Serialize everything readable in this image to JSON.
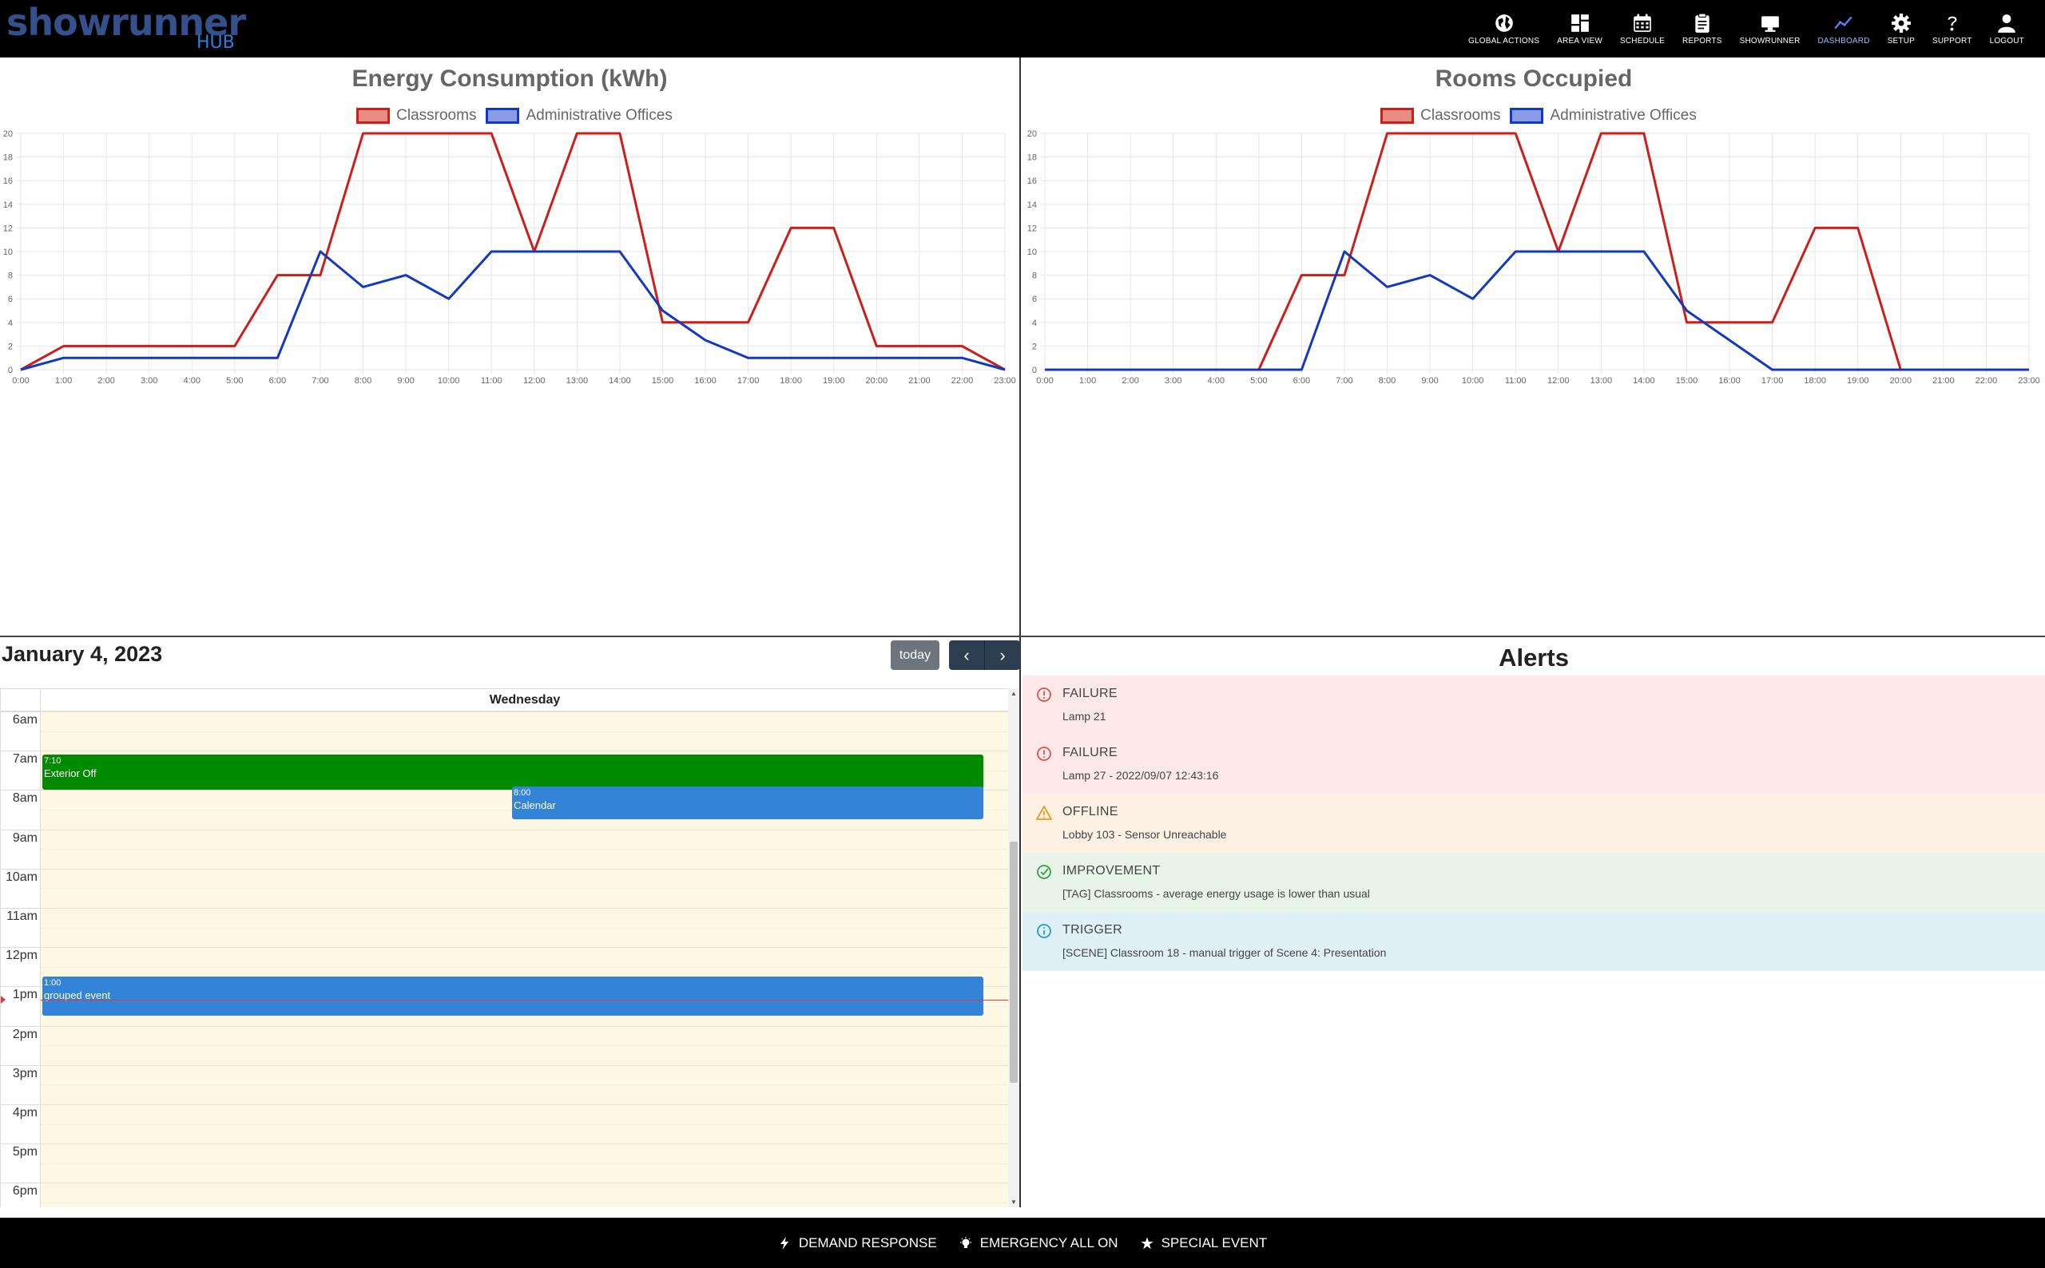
{
  "app": {
    "logo_text": "showrunner",
    "logo_sub": "HUB"
  },
  "nav": {
    "items": [
      {
        "label": "GLOBAL ACTIONS",
        "icon": "globe-icon"
      },
      {
        "label": "AREA VIEW",
        "icon": "dashboard-grid-icon"
      },
      {
        "label": "SCHEDULE",
        "icon": "calendar-icon"
      },
      {
        "label": "REPORTS",
        "icon": "clipboard-icon"
      },
      {
        "label": "SHOWRUNNER",
        "icon": "monitor-icon"
      },
      {
        "label": "DASHBOARD",
        "icon": "chart-line-icon",
        "active": true
      },
      {
        "label": "SETUP",
        "icon": "gear-icon"
      },
      {
        "label": "SUPPORT",
        "icon": "question-icon"
      },
      {
        "label": "LOGOUT",
        "icon": "user-icon"
      }
    ]
  },
  "colors": {
    "classrooms": "#cc1f1a",
    "classrooms_fill": "#e88c84",
    "admin": "#1239c0",
    "admin_fill": "#8a9ce8",
    "green_event": "#008a00",
    "blue_event": "#3383d9"
  },
  "chart_data": [
    {
      "type": "line",
      "title": "Energy Consumption (kWh)",
      "x": [
        "0:00",
        "1:00",
        "2:00",
        "3:00",
        "4:00",
        "5:00",
        "6:00",
        "7:00",
        "8:00",
        "9:00",
        "10:00",
        "11:00",
        "12:00",
        "13:00",
        "14:00",
        "15:00",
        "16:00",
        "17:00",
        "18:00",
        "19:00",
        "20:00",
        "21:00",
        "22:00",
        "23:00"
      ],
      "ylim": [
        0,
        20
      ],
      "yticks": [
        0,
        2,
        4,
        6,
        8,
        10,
        12,
        14,
        16,
        18,
        20
      ],
      "grid": true,
      "legend_position": "top",
      "series": [
        {
          "name": "Classrooms",
          "values": [
            0,
            2,
            2,
            2,
            2,
            2,
            8,
            8,
            20,
            20,
            20,
            20,
            10,
            20,
            20,
            4,
            4,
            4,
            12,
            12,
            2,
            2,
            2,
            0
          ]
        },
        {
          "name": "Administrative Offices",
          "values": [
            0,
            1,
            1,
            1,
            1,
            1,
            1,
            10,
            7,
            8,
            6,
            10,
            10,
            10,
            10,
            5,
            2.5,
            1,
            1,
            1,
            1,
            1,
            1,
            0
          ]
        }
      ]
    },
    {
      "type": "line",
      "title": "Rooms Occupied",
      "x": [
        "0:00",
        "1:00",
        "2:00",
        "3:00",
        "4:00",
        "5:00",
        "6:00",
        "7:00",
        "8:00",
        "9:00",
        "10:00",
        "11:00",
        "12:00",
        "13:00",
        "14:00",
        "15:00",
        "16:00",
        "17:00",
        "18:00",
        "19:00",
        "20:00",
        "21:00",
        "22:00",
        "23:00"
      ],
      "ylim": [
        0,
        20
      ],
      "yticks": [
        0,
        2,
        4,
        6,
        8,
        10,
        12,
        14,
        16,
        18,
        20
      ],
      "grid": true,
      "legend_position": "top",
      "series": [
        {
          "name": "Classrooms",
          "values": [
            0,
            0,
            0,
            0,
            0,
            0,
            8,
            8,
            20,
            20,
            20,
            20,
            10,
            20,
            20,
            4,
            4,
            4,
            12,
            12,
            0,
            0,
            0,
            0
          ]
        },
        {
          "name": "Administrative Offices",
          "values": [
            0,
            0,
            0,
            0,
            0,
            0,
            0,
            10,
            7,
            8,
            6,
            10,
            10,
            10,
            10,
            5,
            2.5,
            0,
            0,
            0,
            0,
            0,
            0,
            0
          ]
        }
      ]
    }
  ],
  "calendar": {
    "date_title": "January 4, 2023",
    "today_label": "today",
    "prev_label": "‹",
    "next_label": "›",
    "day_header": "Wednesday",
    "hours": [
      "6am",
      "7am",
      "8am",
      "9am",
      "10am",
      "11am",
      "12pm",
      "1pm",
      "2pm",
      "3pm",
      "4pm",
      "5pm",
      "6pm"
    ],
    "events": [
      {
        "time": "7:10",
        "title": "Exterior Off",
        "start_hour": 7.1,
        "end_hour": 8.0,
        "column": "full",
        "color": "#008a00"
      },
      {
        "time": "8:00",
        "title": "Calendar",
        "start_hour": 7.92,
        "end_hour": 8.75,
        "column": "right",
        "color": "#3383d9"
      },
      {
        "time": "1:00",
        "title": "grouped event",
        "start_hour": 12.75,
        "end_hour": 13.75,
        "column": "full",
        "color": "#3383d9"
      }
    ],
    "now_hour": 13.33
  },
  "alerts": {
    "title": "Alerts",
    "items": [
      {
        "type": "FAILURE",
        "message": "Lamp 21",
        "level": "failure",
        "icon": "error-circle-icon",
        "bg": "#fce8e8",
        "icon_color": "#d9534f"
      },
      {
        "type": "FAILURE",
        "message": "Lamp 27 - 2022/09/07 12:43:16",
        "level": "failure",
        "icon": "error-circle-icon",
        "bg": "#fce8e8",
        "icon_color": "#d9534f"
      },
      {
        "type": "OFFLINE",
        "message": "Lobby 103 - Sensor Unreachable",
        "level": "warning",
        "icon": "warning-triangle-icon",
        "bg": "#fcf1e3",
        "icon_color": "#e89a1a"
      },
      {
        "type": "IMPROVEMENT",
        "message": "[TAG] Classrooms - average energy usage is lower than usual",
        "level": "success",
        "icon": "check-circle-icon",
        "bg": "#e8f4e8",
        "icon_color": "#3aa048"
      },
      {
        "type": "TRIGGER",
        "message": "[SCENE] Classroom 18 - manual trigger of Scene 4: Presentation",
        "level": "info",
        "icon": "info-circle-icon",
        "bg": "#dff1f7",
        "icon_color": "#1f9fd6"
      }
    ]
  },
  "footer": {
    "items": [
      {
        "label": "DEMAND RESPONSE",
        "icon": "bolt-icon"
      },
      {
        "label": "EMERGENCY ALL ON",
        "icon": "lightbulb-icon"
      },
      {
        "label": "SPECIAL EVENT",
        "icon": "star-icon"
      }
    ]
  }
}
